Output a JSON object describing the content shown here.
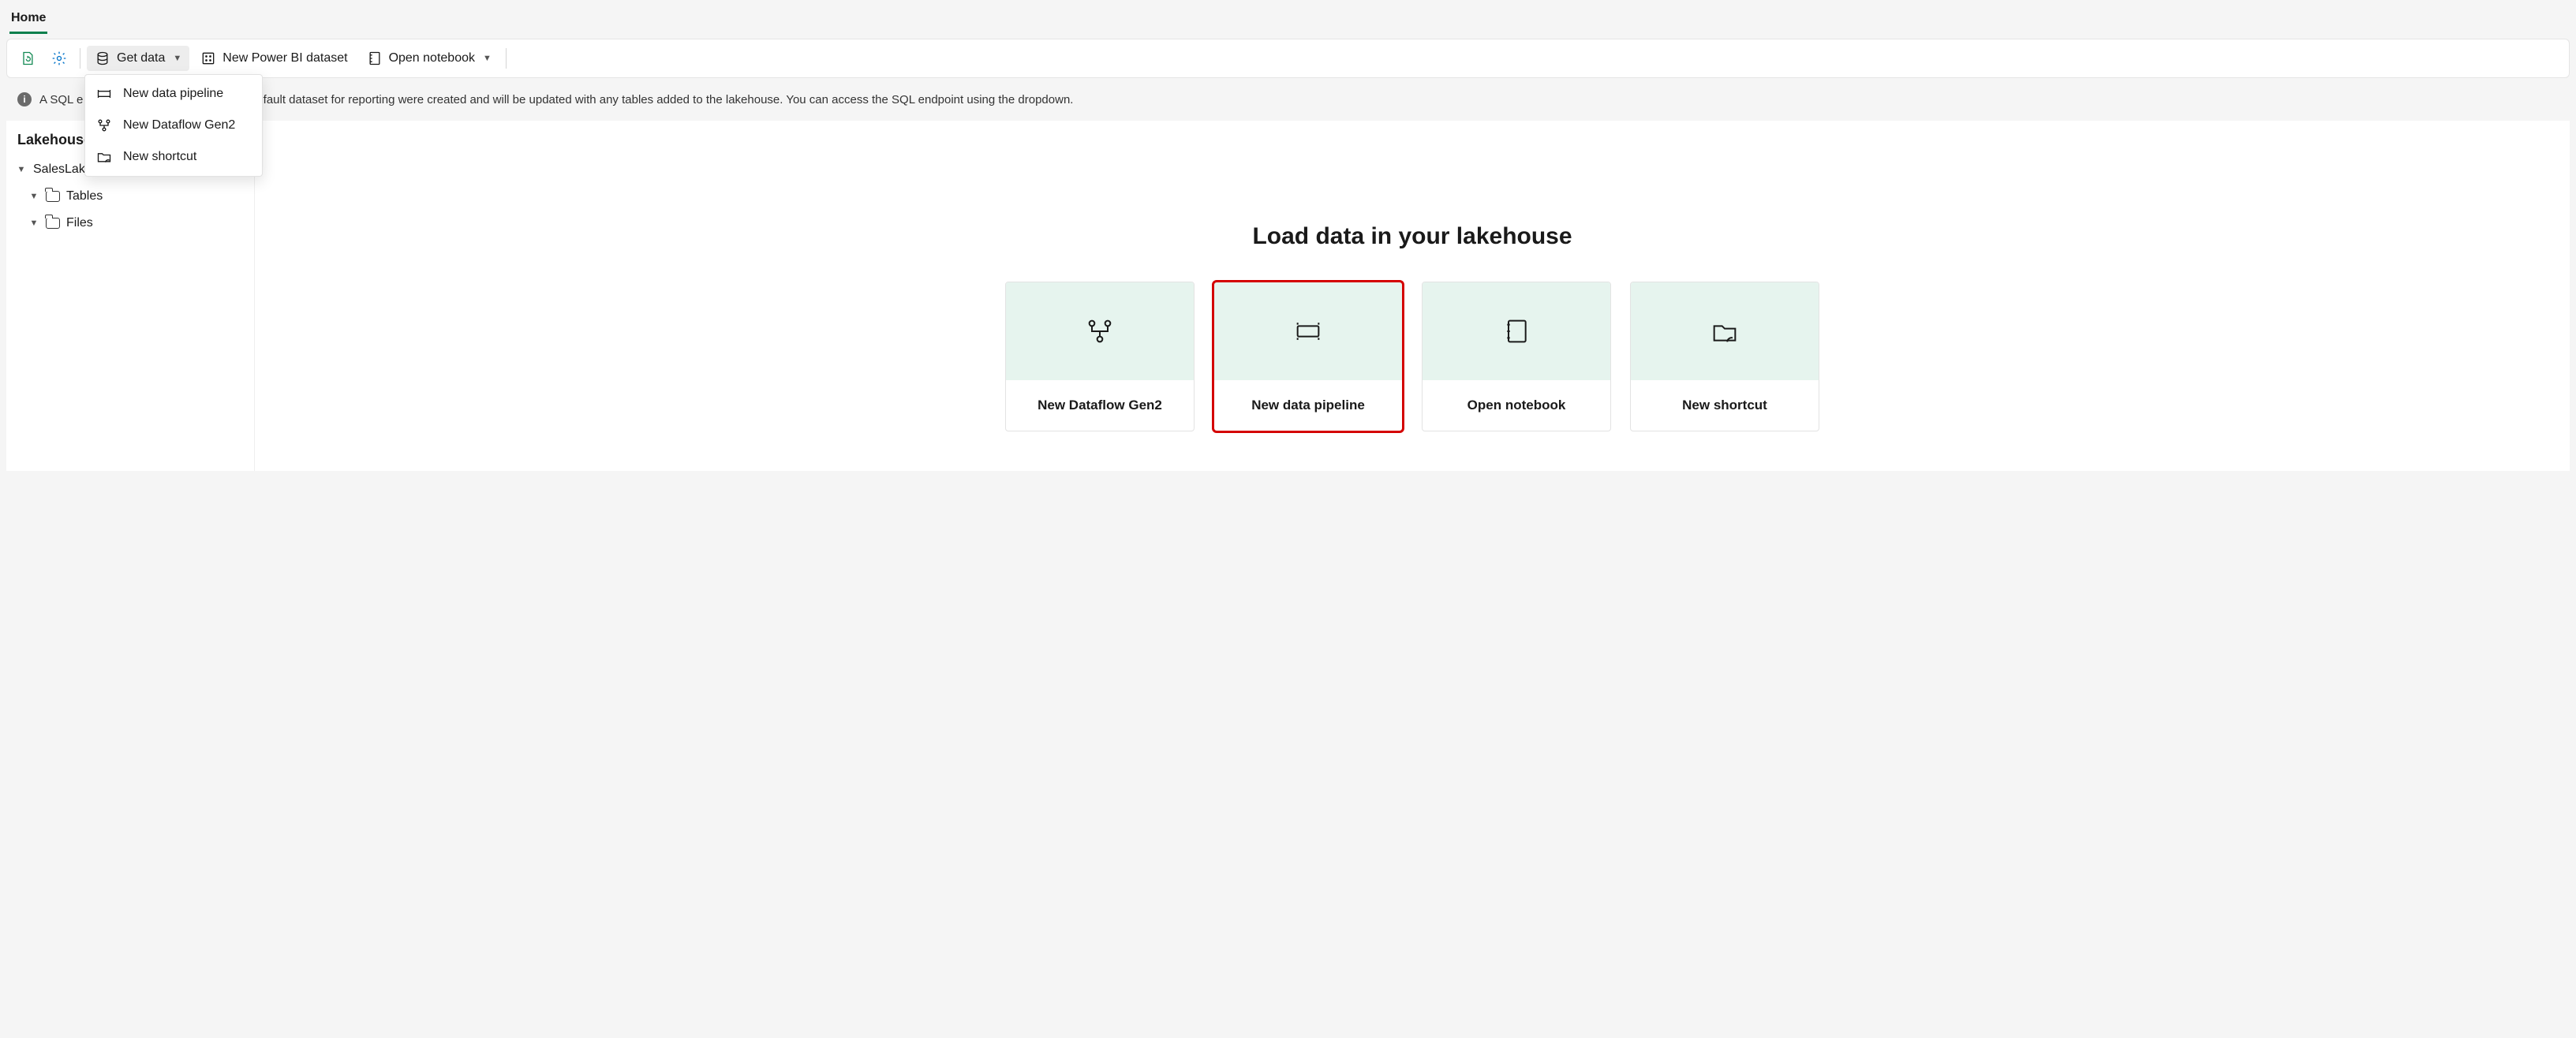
{
  "tabs": {
    "home": "Home"
  },
  "toolbar": {
    "get_data": "Get data",
    "new_dataset": "New Power BI dataset",
    "open_notebook": "Open notebook"
  },
  "get_data_menu": {
    "pipeline": "New data pipeline",
    "dataflow": "New Dataflow Gen2",
    "shortcut": "New shortcut"
  },
  "info_bar": {
    "prefix": "A SQL e",
    "rest": "efault dataset for reporting were created and will be updated with any tables added to the lakehouse. You can access the SQL endpoint using the dropdown."
  },
  "explorer": {
    "title": "Lakehouse",
    "root": "SalesLakehouse",
    "nodes": {
      "tables": "Tables",
      "files": "Files"
    }
  },
  "main": {
    "heading": "Load data in your lakehouse",
    "cards": {
      "dataflow": "New Dataflow Gen2",
      "pipeline": "New data pipeline",
      "notebook": "Open notebook",
      "shortcut": "New shortcut"
    }
  }
}
